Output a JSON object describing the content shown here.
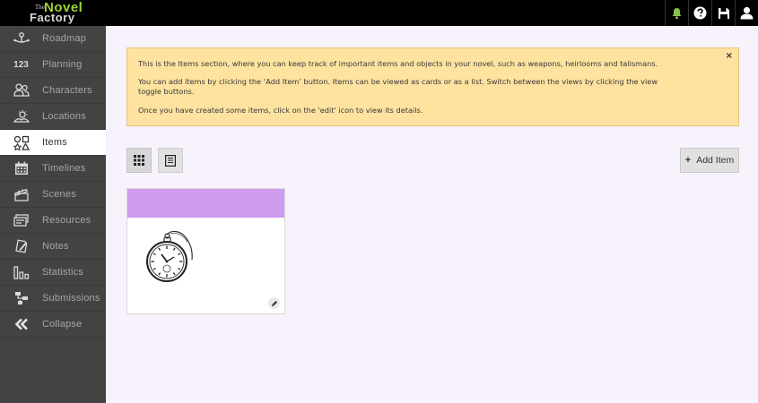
{
  "app": {
    "logo": {
      "the": "The",
      "novel": "Novel",
      "factory": "Factory"
    },
    "top_icons": [
      "bell-icon",
      "help-icon",
      "save-icon",
      "user-icon"
    ]
  },
  "sidebar": {
    "items": [
      {
        "label": "Roadmap",
        "icon": "roadmap-icon"
      },
      {
        "label": "Planning",
        "icon": "123"
      },
      {
        "label": "Characters",
        "icon": "characters-icon"
      },
      {
        "label": "Locations",
        "icon": "locations-icon"
      },
      {
        "label": "Items",
        "icon": "items-icon",
        "active": true
      },
      {
        "label": "Timelines",
        "icon": "calendar-icon"
      },
      {
        "label": "Scenes",
        "icon": "clapperboard-icon"
      },
      {
        "label": "Resources",
        "icon": "resources-icon"
      },
      {
        "label": "Notes",
        "icon": "notes-icon"
      },
      {
        "label": "Statistics",
        "icon": "statistics-icon"
      },
      {
        "label": "Submissions",
        "icon": "submissions-icon"
      },
      {
        "label": "Collapse",
        "icon": "collapse-icon"
      }
    ]
  },
  "banner": {
    "line1": "This is the Items section, where you can keep track of important items and objects in your novel, such as weapons, heirlooms and talismans.",
    "line2": "You can add items by clicking the ‘Add Item’ button. Items can be viewed as cards or as a list. Switch between the views by clicking the view toggle buttons.",
    "line3": "Once you have created some items, click on the 'edit' icon to view its details.",
    "close": "×"
  },
  "toolbar": {
    "add_item_label": "Add Item",
    "add_item_plus": "+"
  },
  "colors": {
    "card_header": "#cf9bec",
    "banner_bg": "#fde2a0",
    "logo_green": "#9ad336",
    "bell_green": "#8bc34a",
    "sidebar_bg": "#434343"
  }
}
